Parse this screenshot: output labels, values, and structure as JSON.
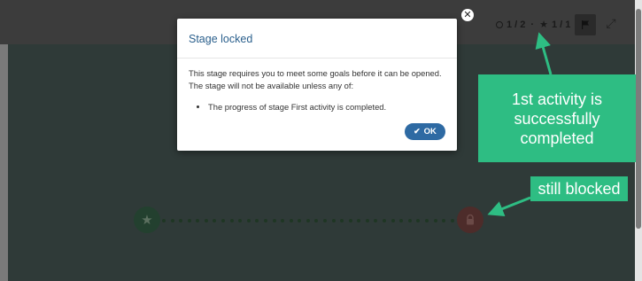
{
  "header": {
    "activity_progress": "1 / 2",
    "star_progress": "1 / 1"
  },
  "modal": {
    "title": "Stage locked",
    "line1": "This stage requires you to meet some goals before it can be opened.",
    "line2": "The stage will not be available unless any of:",
    "condition": "The progress of stage First activity is completed.",
    "ok_label": "OK",
    "close_glyph": "✕"
  },
  "annotations": {
    "completed": "1st activity is successfully completed",
    "blocked": "still blocked"
  },
  "colors": {
    "callout": "#2ebd83",
    "ok_button": "#2e6aa3",
    "modal_title": "#2a5f8c"
  },
  "icons": {
    "start_node": "star-icon",
    "locked_node": "lock-icon",
    "flag_button": "flag-icon",
    "fullscreen": "expand-icon"
  }
}
